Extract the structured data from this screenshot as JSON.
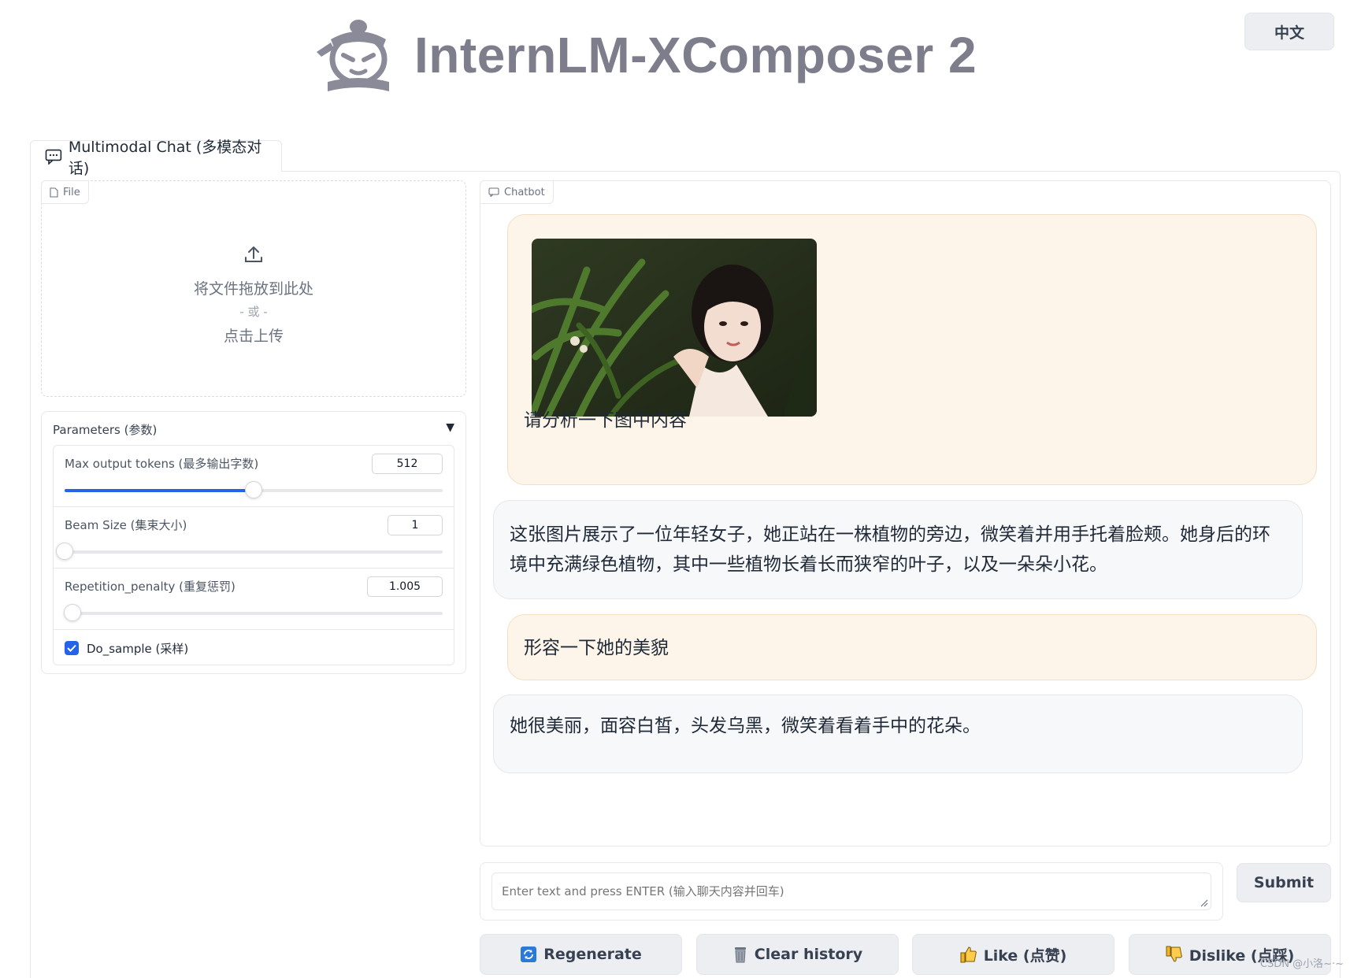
{
  "header": {
    "title": "InternLM-XComposer 2",
    "lang_button": "中文"
  },
  "tab": {
    "label": "Multimodal Chat (多模态对话)"
  },
  "file_upload": {
    "label": "File",
    "drop_text": "将文件拖放到此处",
    "or_text": "- 或 -",
    "click_text": "点击上传"
  },
  "parameters": {
    "title": "Parameters (参数)",
    "max_tokens": {
      "label": "Max output tokens (最多输出字数)",
      "value": "512",
      "fraction": 0.5
    },
    "beam_size": {
      "label": "Beam Size (集束大小)",
      "value": "1",
      "fraction": 0.0
    },
    "repetition_penalty": {
      "label": "Repetition_penalty (重复惩罚)",
      "value": "1.005",
      "fraction": 0.02
    },
    "do_sample": {
      "label": "Do_sample (采样)",
      "checked": true
    }
  },
  "chatbot": {
    "label": "Chatbot",
    "messages": [
      {
        "role": "user",
        "has_image": true,
        "text": "请分析一下图中内容"
      },
      {
        "role": "bot",
        "text": "这张图片展示了一位年轻女子，她正站在一株植物的旁边，微笑着并用手托着脸颊。她身后的环境中充满绿色植物，其中一些植物长着长而狭窄的叶子，以及一朵朵小花。"
      },
      {
        "role": "user",
        "text": "形容一下她的美貌"
      },
      {
        "role": "bot",
        "text": "她很美丽，面容白皙，头发乌黑，微笑着看着手中的花朵。"
      }
    ]
  },
  "input": {
    "placeholder": "Enter text and press ENTER (输入聊天内容并回车)"
  },
  "buttons": {
    "submit": "Submit",
    "regenerate": "Regenerate",
    "clear": "Clear history",
    "like": "Like (点赞)",
    "dislike": "Dislike (点踩)"
  },
  "watermark": "CSDN @小洛~·~"
}
